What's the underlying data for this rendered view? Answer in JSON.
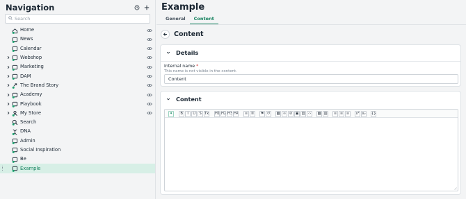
{
  "nav": {
    "title": "Navigation",
    "search_placeholder": "Search",
    "items": [
      {
        "label": "Home",
        "icon": "home-page-icon",
        "chevron": false,
        "eye": true,
        "selected": false
      },
      {
        "label": "News",
        "icon": "page-icon",
        "chevron": false,
        "eye": true,
        "selected": false
      },
      {
        "label": "Calendar",
        "icon": "page-icon",
        "chevron": false,
        "eye": true,
        "selected": false
      },
      {
        "label": "Webshop",
        "icon": "page-icon",
        "chevron": true,
        "eye": true,
        "selected": false
      },
      {
        "label": "Marketing",
        "icon": "page-icon",
        "chevron": true,
        "eye": true,
        "selected": false
      },
      {
        "label": "DAM",
        "icon": "page-icon",
        "chevron": true,
        "eye": true,
        "selected": false
      },
      {
        "label": "The Brand Story",
        "icon": "link-page-icon",
        "chevron": true,
        "eye": true,
        "selected": false
      },
      {
        "label": "Academy",
        "icon": "page-icon",
        "chevron": true,
        "eye": true,
        "selected": false
      },
      {
        "label": "Playbook",
        "icon": "page-icon",
        "chevron": true,
        "eye": true,
        "selected": false
      },
      {
        "label": "My Store",
        "icon": "user-page-icon",
        "chevron": true,
        "eye": true,
        "selected": false
      },
      {
        "label": "Search",
        "icon": "search-page-icon",
        "chevron": false,
        "eye": false,
        "selected": false
      },
      {
        "label": "DNA",
        "icon": "dna-icon",
        "chevron": false,
        "eye": false,
        "selected": false
      },
      {
        "label": "Admin",
        "icon": "page-icon",
        "chevron": false,
        "eye": false,
        "selected": false
      },
      {
        "label": "Social Inspiration",
        "icon": "page-icon",
        "chevron": false,
        "eye": false,
        "selected": false
      },
      {
        "label": "Be",
        "icon": "page-icon",
        "chevron": false,
        "eye": false,
        "selected": false
      },
      {
        "label": "Example",
        "icon": "page-icon",
        "chevron": false,
        "eye": false,
        "selected": true
      }
    ]
  },
  "main": {
    "title": "Example",
    "tabs": [
      {
        "label": "General",
        "active": false
      },
      {
        "label": "Content",
        "active": true
      }
    ],
    "section_heading": "Content",
    "details": {
      "title": "Details",
      "field_label": "Internal name",
      "required_mark": "*",
      "field_help": "This name is not visible in the content.",
      "field_value": "Content"
    },
    "content_panel": {
      "title": "Content",
      "toolbar": [
        "ai",
        "B",
        "I",
        "U",
        "S",
        "Tx",
        "H1",
        "H2",
        "H3",
        "H4",
        "ul",
        "ol",
        "flag",
        "clear",
        "table",
        "link",
        "unlink",
        "image",
        "media",
        "code",
        "grid",
        "grid2",
        "left",
        "center",
        "right",
        "x²",
        "x₂",
        "{}"
      ]
    }
  },
  "colors": {
    "accent": "#12805c",
    "selected_bg": "#d7efe6",
    "required": "#d13c3c"
  }
}
